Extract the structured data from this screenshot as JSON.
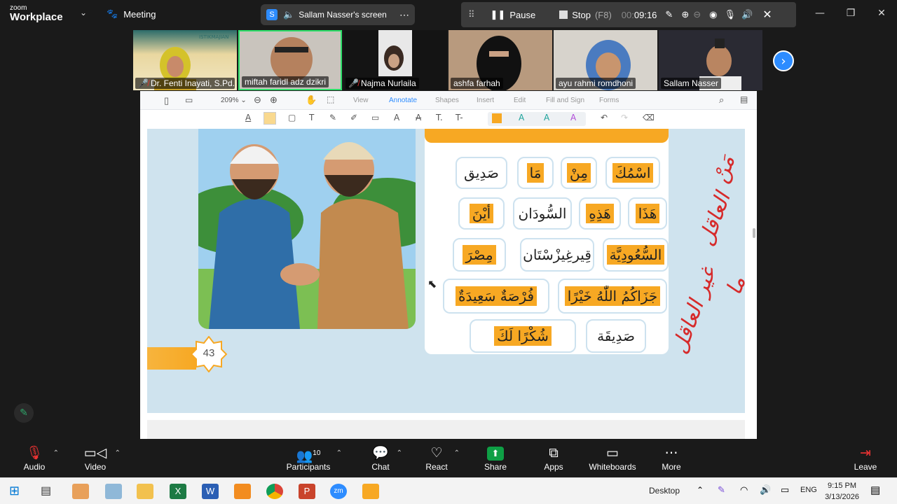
{
  "app": {
    "logo_line1": "zoom",
    "logo_line2": "Workplace",
    "meeting_label": "Meeting"
  },
  "screen_share": {
    "label": "Sallam Nasser's screen",
    "badge": "S"
  },
  "share_controls": {
    "pause": "Pause",
    "stop": "Stop",
    "stop_shortcut": "(F8)",
    "timer_dim": "00:",
    "timer": "09:16"
  },
  "participants_strip": [
    {
      "name": "Dr. Fenti Inayati, S.Pd....",
      "muted": true
    },
    {
      "name": "miftah faridl adz dzikri",
      "muted": false
    },
    {
      "name": "Najma Nurlaila",
      "muted": true
    },
    {
      "name": "ashfa farhah",
      "muted": false
    },
    {
      "name": "ayu rahmi romdhoni",
      "muted": false
    },
    {
      "name": "Sallam Nasser",
      "muted": false
    }
  ],
  "pdf": {
    "zoom": "209%",
    "menus": [
      "View",
      "Annotate",
      "Shapes",
      "Insert",
      "Edit",
      "Fill and Sign",
      "Forms"
    ],
    "active_menu": "Annotate",
    "page_number": "43"
  },
  "vocab_cards": [
    {
      "text": "اسْمُكَ",
      "highlight": true
    },
    {
      "text": "مِنْ",
      "highlight": true
    },
    {
      "text": "مَا",
      "highlight": true
    },
    {
      "text": "صَدِيق",
      "highlight": false
    },
    {
      "text": "هَذَا",
      "highlight": true
    },
    {
      "text": "هَذِهِ",
      "highlight": true
    },
    {
      "text": "السُّودَان",
      "highlight": false
    },
    {
      "text": "أيْنَ",
      "highlight": true
    },
    {
      "text": "السُّعُودِيَّة",
      "highlight": true
    },
    {
      "text": "قِيرغِيزْسْتَان",
      "highlight": false
    },
    {
      "text": "مِصْرَ",
      "highlight": true
    },
    {
      "text": "جَزَاكُمُ اللّٰهُ خَيْرًا",
      "highlight": true
    },
    {
      "text": "فُرْصَةٌ سَعِيدَةٌ",
      "highlight": true
    },
    {
      "text": "صَدِيقَة",
      "highlight": false
    },
    {
      "text": "شُكْرًا لَكَ",
      "highlight": true
    }
  ],
  "handwriting": {
    "line1": "مَنْ",
    "line2": "العاقل",
    "line3": "ما",
    "line4": "غير العاقل"
  },
  "bottom_bar": {
    "audio": "Audio",
    "video": "Video",
    "participants": "Participants",
    "participants_count": "10",
    "chat": "Chat",
    "react": "React",
    "share": "Share",
    "apps": "Apps",
    "whiteboards": "Whiteboards",
    "more": "More",
    "leave": "Leave"
  },
  "taskbar": {
    "desktop": "Desktop",
    "lang": "ENG",
    "time": "9:15 PM",
    "date": "3/13/2026"
  },
  "colors": {
    "accent": "#2d8cff",
    "highlight": "#f7a823",
    "share_green": "#0e9f45",
    "mute_red": "#e33"
  }
}
